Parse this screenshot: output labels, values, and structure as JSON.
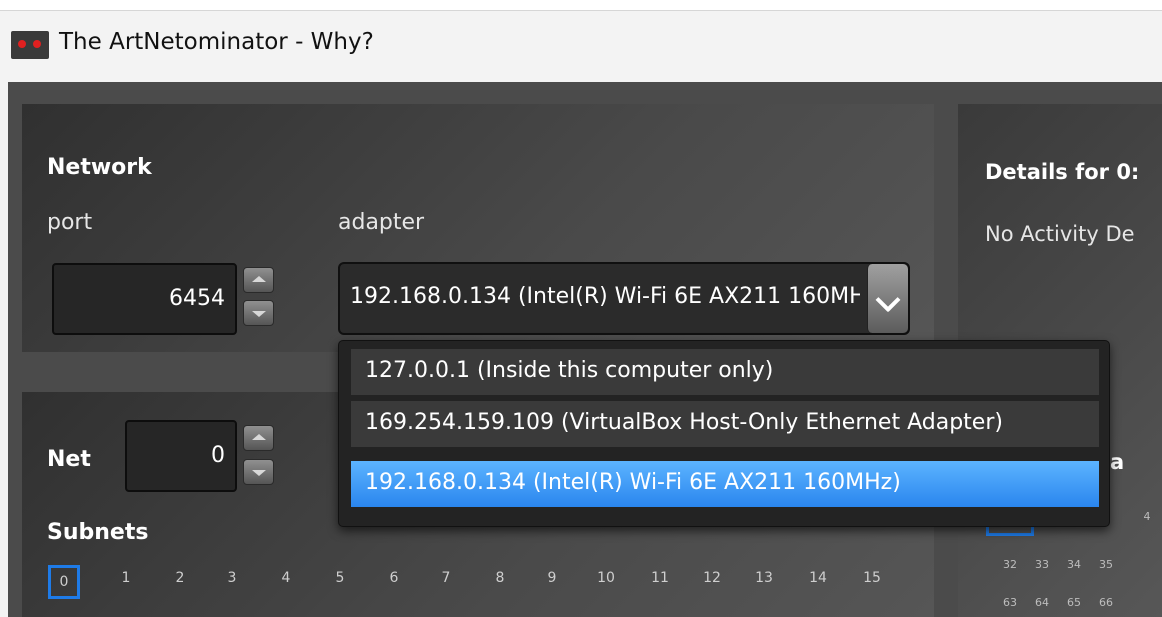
{
  "window": {
    "title": "The ArtNetominator - Why?"
  },
  "network": {
    "heading": "Network",
    "port_label": "port",
    "port_value": "6454",
    "adapter_label": "adapter",
    "adapter_value": "192.168.0.134 (Intel(R) Wi-Fi 6E AX211 160MHz)"
  },
  "adapter_options": [
    "127.0.0.1 (Inside this computer only)",
    "169.254.159.109 (VirtualBox Host-Only Ethernet Adapter)",
    "192.168.0.134 (Intel(R) Wi-Fi 6E AX211 160MHz)"
  ],
  "net": {
    "label": "Net",
    "value": "0"
  },
  "subnets": {
    "heading": "Subnets",
    "items": [
      "0",
      "1",
      "2",
      "3",
      "4",
      "5",
      "6",
      "7",
      "8",
      "9",
      "10",
      "11",
      "12",
      "13",
      "14",
      "15"
    ],
    "selected": "0"
  },
  "details": {
    "heading": "Details for 0:",
    "status": "No Activity De",
    "partial_label": "a",
    "row1": [
      "4"
    ],
    "row2": [
      "32",
      "33",
      "34",
      "35"
    ],
    "row3": [
      "63",
      "64",
      "65",
      "66"
    ]
  },
  "colors": {
    "accent": "#1e7be8",
    "selection": "#3e9cf7",
    "panel": "#3c3c3c"
  }
}
